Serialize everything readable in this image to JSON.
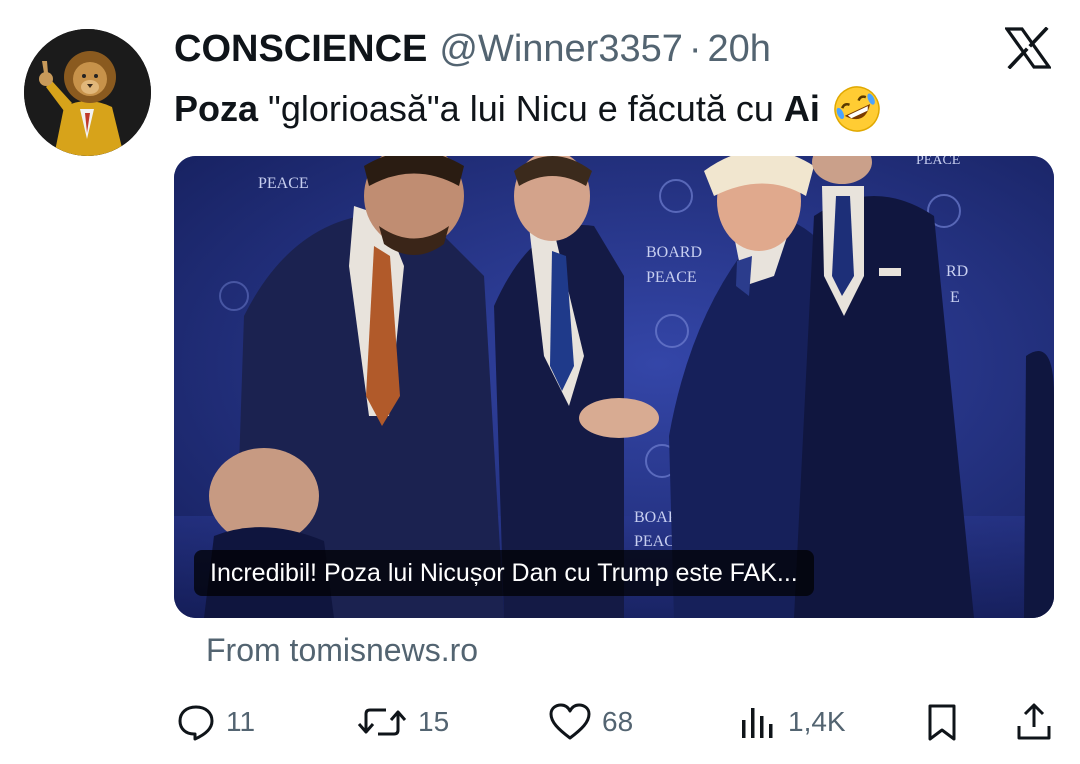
{
  "user": {
    "display_name": "CONSCIENCE",
    "handle": "@Winner3357",
    "separator": "·",
    "time": "20h",
    "avatar_icon": "lion-in-suit-avatar"
  },
  "tweet": {
    "bold_start": "Poza",
    "text_middle": " \"glorioasă\"a lui Nicu e făcută cu ",
    "bold_end": "Ai",
    "emoji": "rolling-on-floor-laughing-emoji"
  },
  "media": {
    "caption": "Incredibil! Poza lui Nicușor Dan cu Trump este FAK...",
    "backdrop_texts": {
      "peace_top": "PEACE",
      "board_mid": "BOARD",
      "peace_mid": "PEACE",
      "board_low": "BOAR",
      "peace_low": "PEACI",
      "peace_right": "PEACE",
      "rd_right": "RD",
      "e_right": "E"
    }
  },
  "link_source": "From tomisnews.ro",
  "actions": {
    "replies": "11",
    "reposts": "15",
    "likes": "68",
    "views": "1,4K"
  },
  "colors": {
    "text": "#0f1419",
    "secondary": "#536471",
    "backdrop_blue": "#1f2b78"
  }
}
